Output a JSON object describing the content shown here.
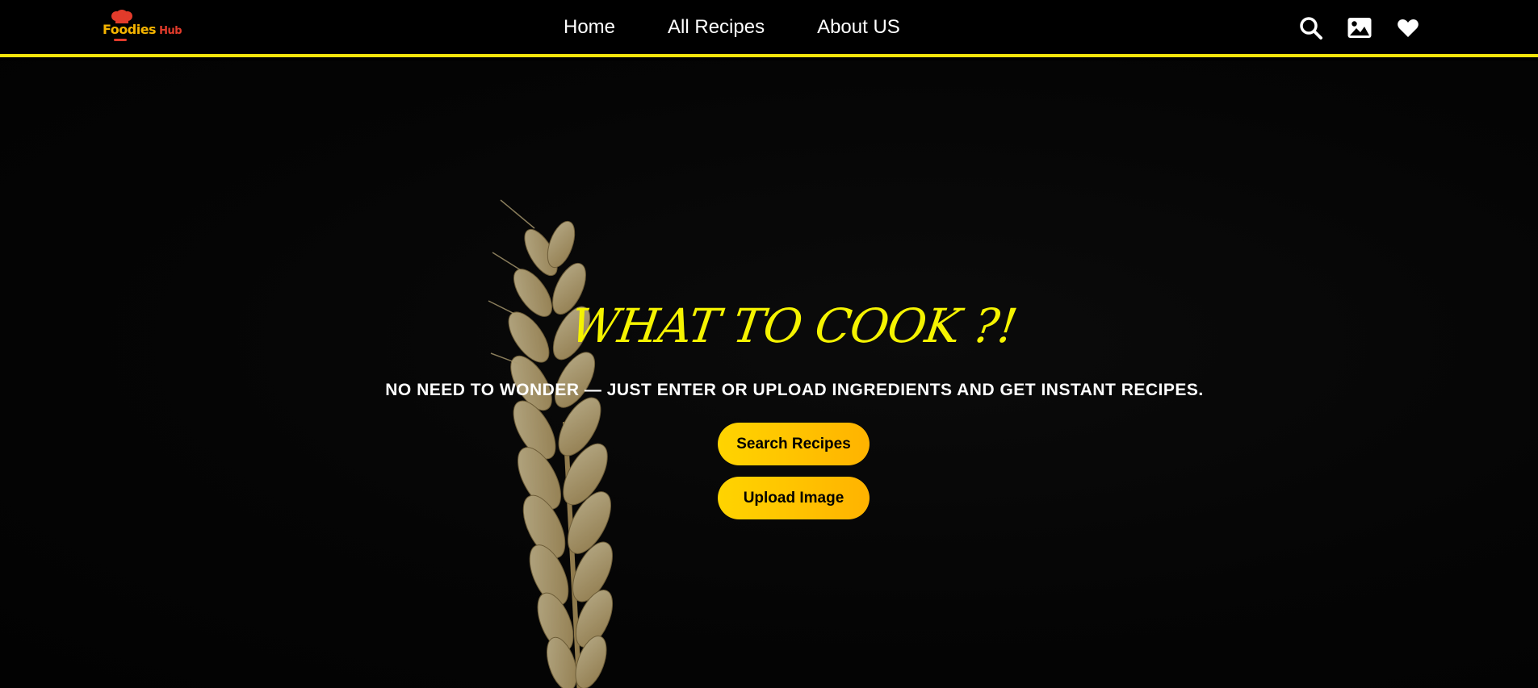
{
  "brand": {
    "word1": "Foodies",
    "word2": "Hub",
    "primary_color": "#f5b400",
    "secondary_color": "#e23b2b"
  },
  "nav": {
    "links": [
      {
        "label": "Home"
      },
      {
        "label": "All Recipes"
      },
      {
        "label": "About US"
      }
    ],
    "icons": [
      "search-icon",
      "image-icon",
      "heart-icon"
    ],
    "accent_border": "#f5e50b"
  },
  "hero": {
    "title": "WHAT TO COOK ?!",
    "subtitle": "NO NEED TO WONDER — JUST ENTER OR UPLOAD INGREDIENTS AND GET INSTANT RECIPES.",
    "title_color": "#f5f300",
    "buttons": {
      "search_label": "Search Recipes",
      "upload_label": "Upload Image"
    },
    "button_gradient": [
      "#ffd400",
      "#ffb300"
    ]
  }
}
